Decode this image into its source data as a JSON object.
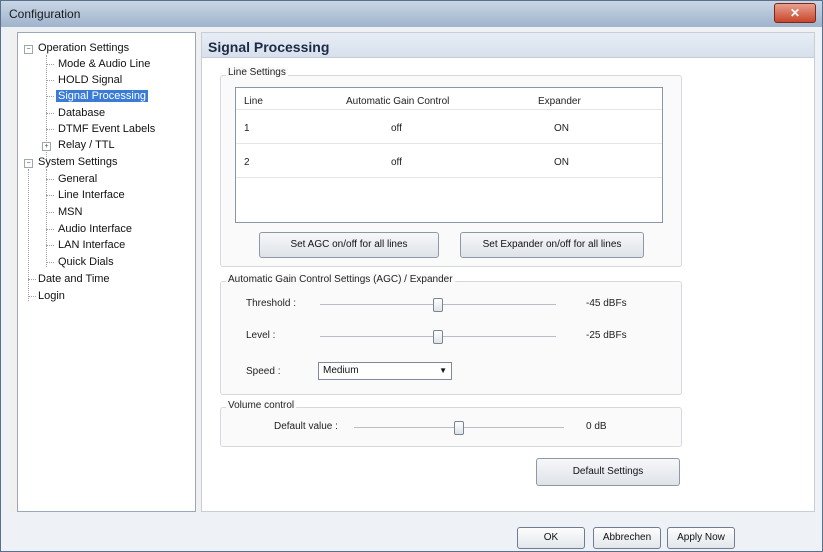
{
  "window": {
    "title": "Configuration",
    "close_label": "✕"
  },
  "tree": {
    "items": [
      {
        "label": "Operation Settings"
      },
      {
        "label": "Mode & Audio Line"
      },
      {
        "label": "HOLD Signal"
      },
      {
        "label": "Signal Processing"
      },
      {
        "label": "Database"
      },
      {
        "label": "DTMF Event Labels"
      },
      {
        "label": "Relay / TTL"
      },
      {
        "label": "System Settings"
      },
      {
        "label": "General"
      },
      {
        "label": "Line Interface"
      },
      {
        "label": "MSN"
      },
      {
        "label": "Audio Interface"
      },
      {
        "label": "LAN Interface"
      },
      {
        "label": "Quick Dials"
      },
      {
        "label": "Date and Time"
      },
      {
        "label": "Login"
      }
    ]
  },
  "panel": {
    "title": "Signal Processing"
  },
  "line_settings": {
    "group_label": "Line Settings",
    "headers": [
      "Line",
      "Automatic Gain Control",
      "Expander"
    ],
    "rows": [
      [
        "1",
        "off",
        "ON"
      ],
      [
        "2",
        "off",
        "ON"
      ]
    ],
    "agc_button": "Set AGC on/off for all lines",
    "expander_button": "Set Expander on/off for all lines"
  },
  "agc": {
    "group_label": "Automatic Gain Control Settings (AGC) / Expander",
    "threshold_label": "Threshold :",
    "threshold_value": "-45 dBFs",
    "threshold_level": 0.5,
    "level_label": "Level :",
    "level_value": "-25 dBFs",
    "level_level": 0.5,
    "speed_label": "Speed :",
    "speed_value": "Medium"
  },
  "volume": {
    "group_label": "Volume control",
    "default_label": "Default value :",
    "default_value": "0 dB",
    "default_level": 0.5
  },
  "default_settings_button": "Default Settings",
  "footer": {
    "ok": "OK",
    "cancel": "Abbrechen",
    "apply": "Apply Now"
  }
}
